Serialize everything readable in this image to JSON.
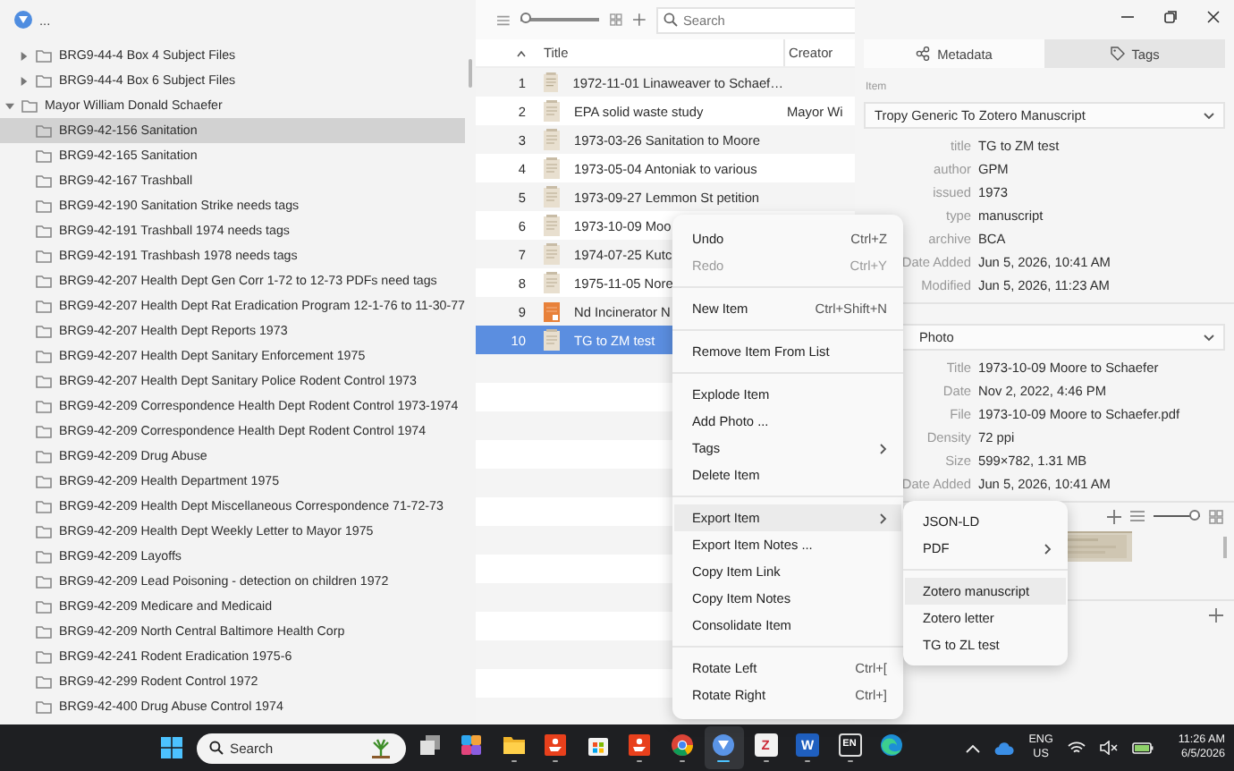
{
  "sidebar": {
    "project_label": "...",
    "scrolled_group": [
      {
        "label": "BRG9-44-4 Box 4 Subject Files",
        "expanded": false,
        "selected": false
      },
      {
        "label": "BRG9-44-4 Box 6 Subject Files",
        "expanded": false,
        "selected": false
      }
    ],
    "items": [
      {
        "label": "Mayor William Donald Schaefer",
        "expanded": true,
        "selected": false,
        "children": [
          {
            "label": "BRG9-42-156 Sanitation",
            "selected": true
          },
          {
            "label": "BRG9-42-165 Sanitation",
            "selected": false
          },
          {
            "label": "BRG9-42-167 Trashball",
            "selected": false
          },
          {
            "label": "BRG9-42-190 Sanitation Strike needs tags",
            "selected": false
          },
          {
            "label": "BRG9-42-191 Trashball 1974 needs tags",
            "selected": false
          },
          {
            "label": "BRG9-42-191 Trashbash 1978 needs tags",
            "selected": false
          },
          {
            "label": "BRG9-42-207 Health Dept Gen Corr 1-72 to 12-73 PDFs need tags",
            "selected": false
          },
          {
            "label": "BRG9-42-207 Health Dept Rat Eradication Program 12-1-76 to 11-30-77",
            "selected": false
          },
          {
            "label": "BRG9-42-207 Health Dept Reports 1973",
            "selected": false
          },
          {
            "label": "BRG9-42-207 Health Dept Sanitary Enforcement 1975",
            "selected": false
          },
          {
            "label": "BRG9-42-207 Health Dept Sanitary Police Rodent Control 1973",
            "selected": false
          },
          {
            "label": "BRG9-42-209 Correspondence Health Dept Rodent Control 1973-1974",
            "selected": false
          },
          {
            "label": "BRG9-42-209 Correspondence Health Dept Rodent Control 1974",
            "selected": false
          },
          {
            "label": "BRG9-42-209 Drug Abuse",
            "selected": false
          },
          {
            "label": "BRG9-42-209 Health Department 1975",
            "selected": false
          },
          {
            "label": "BRG9-42-209 Health Dept Miscellaneous Correspondence 71-72-73",
            "selected": false
          },
          {
            "label": "BRG9-42-209 Health Dept Weekly Letter to Mayor 1975",
            "selected": false
          },
          {
            "label": "BRG9-42-209 Layoffs",
            "selected": false
          },
          {
            "label": "BRG9-42-209 Lead Poisoning - detection on children 1972",
            "selected": false
          },
          {
            "label": "BRG9-42-209 Medicare and Medicaid",
            "selected": false
          },
          {
            "label": "BRG9-42-209 North Central Baltimore Health Corp",
            "selected": false
          },
          {
            "label": "BRG9-42-241 Rodent Eradication 1975-6",
            "selected": false
          },
          {
            "label": "BRG9-42-299 Rodent Control 1972",
            "selected": false
          },
          {
            "label": "BRG9-42-400 Drug Abuse Control 1974",
            "selected": false
          }
        ]
      }
    ]
  },
  "toolbar": {
    "zoom_slider": {
      "level": 0
    },
    "search": {
      "placeholder": "Search"
    }
  },
  "table": {
    "columns": [
      "Title",
      "Creator"
    ],
    "rows": [
      {
        "number": "1",
        "kind": "document",
        "title": "1972-11-01 Linaweaver to Schaef…",
        "selected": false
      },
      {
        "number": "2",
        "kind": "document",
        "title": "EPA solid waste study",
        "creator": "Mayor Wi",
        "selected": false
      },
      {
        "number": "3",
        "kind": "document",
        "title": "1973-03-26 Sanitation to Moore",
        "selected": false
      },
      {
        "number": "4",
        "kind": "document",
        "title": "1973-05-04 Antoniak to various",
        "selected": false
      },
      {
        "number": "5",
        "kind": "document",
        "title": "1973-09-27 Lemmon St petition",
        "selected": false
      },
      {
        "number": "6",
        "kind": "document",
        "title": "1973-10-09 Moo",
        "selected": false
      },
      {
        "number": "7",
        "kind": "document",
        "title": "1974-07-25 Kutc",
        "selected": false
      },
      {
        "number": "8",
        "kind": "document",
        "title": "1975-11-05 Nore",
        "selected": false
      },
      {
        "number": "9",
        "kind": "pdf",
        "title": "Nd Incinerator N",
        "selected": false
      },
      {
        "number": "10",
        "kind": "document",
        "title": "TG to ZM test",
        "selected": true
      }
    ]
  },
  "inspector": {
    "tabs": [
      {
        "label": "Metadata",
        "kind": "metadata",
        "selected": true
      },
      {
        "label": "Tags",
        "kind": "tags",
        "selected": false
      }
    ],
    "item_heading": "Item",
    "item_template": "Tropy Generic To Zotero Manuscript",
    "item_fields": [
      {
        "label": "title",
        "value": "TG to ZM test"
      },
      {
        "label": "author",
        "value": "GPM"
      },
      {
        "label": "issued",
        "value": "1973"
      },
      {
        "label": "type",
        "value": "manuscript"
      },
      {
        "label": "archive",
        "value": "BCA"
      },
      {
        "label": "Date Added",
        "value": "Jun 5, 2026, 10:41 AM"
      },
      {
        "label": "Modified",
        "value": "Jun 5, 2026, 11:23 AM"
      }
    ],
    "photo_template": "Photo",
    "photo_fields": [
      {
        "label": "Title",
        "value": "1973-10-09 Moore to Schaefer"
      },
      {
        "label": "Date",
        "value": "Nov 2, 2022, 4:46 PM"
      },
      {
        "label": "File",
        "value": "1973-10-09 Moore to Schaefer.pdf"
      },
      {
        "label": "Density",
        "value": "72 ppi"
      },
      {
        "label": "Size",
        "value": "599×782, 1.31 MB"
      },
      {
        "label": "Date Added",
        "value": "Jun 5, 2026, 10:41 AM"
      }
    ],
    "photo_slider": {
      "level": 1
    }
  },
  "context_menu": {
    "items": [
      {
        "kind": "item",
        "label": "Undo",
        "shortcut": "Ctrl+Z",
        "submenu": false,
        "disabled": false,
        "selected": false
      },
      {
        "kind": "item",
        "label": "Redo",
        "shortcut": "Ctrl+Y",
        "submenu": false,
        "disabled": true,
        "selected": false
      },
      {
        "kind": "separator"
      },
      {
        "kind": "item",
        "label": "New Item",
        "shortcut": "Ctrl+Shift+N",
        "submenu": false,
        "disabled": false,
        "selected": false
      },
      {
        "kind": "separator"
      },
      {
        "kind": "item",
        "label": "Remove Item From List",
        "submenu": false,
        "disabled": false,
        "selected": false
      },
      {
        "kind": "separator"
      },
      {
        "kind": "item",
        "label": "Explode Item",
        "submenu": false,
        "disabled": false,
        "selected": false
      },
      {
        "kind": "item",
        "label": "Add Photo ...",
        "submenu": false,
        "disabled": false,
        "selected": false
      },
      {
        "kind": "item",
        "label": "Tags",
        "submenu": true,
        "disabled": false,
        "selected": false
      },
      {
        "kind": "item",
        "label": "Delete Item",
        "submenu": false,
        "disabled": false,
        "selected": false
      },
      {
        "kind": "separator"
      },
      {
        "kind": "item",
        "label": "Export Item",
        "submenu": true,
        "disabled": false,
        "selected": true
      },
      {
        "kind": "item",
        "label": "Export Item Notes ...",
        "submenu": false,
        "disabled": false,
        "selected": false
      },
      {
        "kind": "item",
        "label": "Copy Item Link",
        "submenu": false,
        "disabled": false,
        "selected": false
      },
      {
        "kind": "item",
        "label": "Copy Item Notes",
        "submenu": false,
        "disabled": false,
        "selected": false
      },
      {
        "kind": "item",
        "label": "Consolidate Item",
        "submenu": false,
        "disabled": false,
        "selected": false
      },
      {
        "kind": "separator"
      },
      {
        "kind": "item",
        "label": "Rotate Left",
        "shortcut": "Ctrl+[",
        "submenu": false,
        "disabled": false,
        "selected": false
      },
      {
        "kind": "item",
        "label": "Rotate Right",
        "shortcut": "Ctrl+]",
        "submenu": false,
        "disabled": false,
        "selected": false
      }
    ]
  },
  "submenu": {
    "items": [
      {
        "kind": "item",
        "label": "JSON-LD",
        "submenu": false,
        "selected": false
      },
      {
        "kind": "item",
        "label": "PDF",
        "submenu": true,
        "selected": false
      },
      {
        "kind": "separator"
      },
      {
        "kind": "item",
        "label": "Zotero manuscript",
        "submenu": false,
        "selected": true
      },
      {
        "kind": "item",
        "label": "Zotero letter",
        "submenu": false,
        "selected": false
      },
      {
        "kind": "item",
        "label": "TG to ZL test",
        "submenu": false,
        "selected": false
      }
    ]
  },
  "taskbar": {
    "search_placeholder": "Search",
    "apps": [
      {
        "kind": "taskview",
        "selected": false,
        "running": false
      },
      {
        "kind": "copilot",
        "selected": false,
        "running": false
      },
      {
        "kind": "explorer",
        "selected": false,
        "running": true
      },
      {
        "kind": "redapp",
        "selected": false,
        "running": true
      },
      {
        "kind": "store",
        "selected": false,
        "running": false
      },
      {
        "kind": "redapp",
        "selected": false,
        "running": true
      },
      {
        "kind": "chrome",
        "selected": false,
        "running": true
      },
      {
        "kind": "tropy",
        "selected": true,
        "running": true
      },
      {
        "kind": "zotero",
        "label": "Z",
        "selected": false,
        "running": true
      },
      {
        "kind": "word",
        "label": "W",
        "selected": false,
        "running": true
      },
      {
        "kind": "en",
        "label": "EN",
        "selected": false,
        "running": true
      },
      {
        "kind": "edge",
        "selected": false,
        "running": false
      }
    ],
    "language": "ENG",
    "region": "US",
    "time": "11:26 AM",
    "date": "6/5/2026"
  }
}
